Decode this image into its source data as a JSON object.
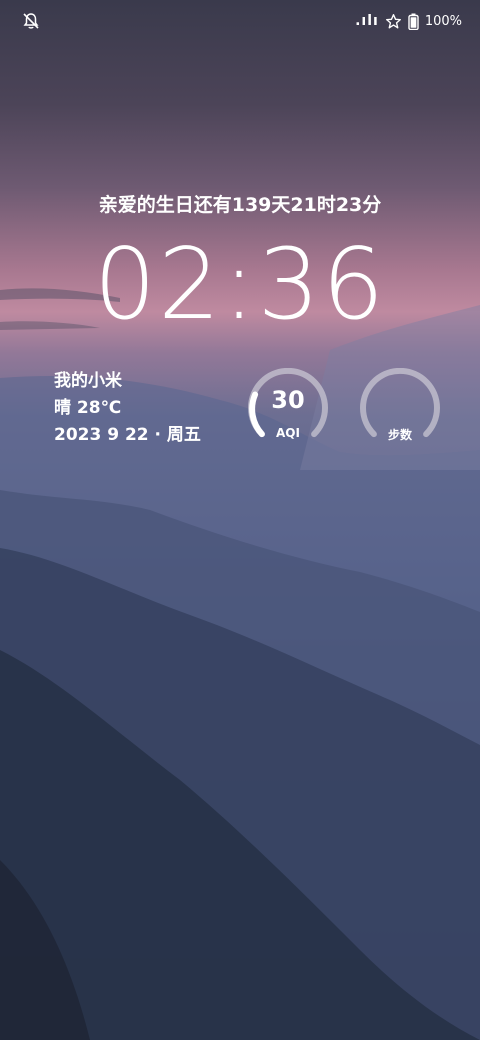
{
  "status_bar": {
    "signal_text": ".ılı",
    "battery_text": "100%",
    "icons": [
      "bell-off-icon",
      "star-icon",
      "battery-icon"
    ]
  },
  "lockscreen": {
    "countdown": "亲爱的生日还有139天21时23分",
    "time": "02:36",
    "device_name": "我的小米",
    "weather": "晴 28℃",
    "date": "2023 9 22 · 周五",
    "aqi": {
      "value": "30",
      "label": "AQI",
      "level": 0.2
    },
    "steps": {
      "value": "",
      "label": "步数",
      "level": 0
    }
  },
  "colors": {
    "ring_track": "#c8c6d2",
    "ring_fill": "#ffffff"
  }
}
